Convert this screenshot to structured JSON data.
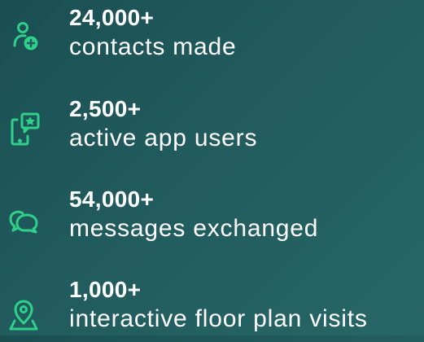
{
  "colors": {
    "background": "#215b5e",
    "accent": "#2fd08a",
    "text": "#ffffff"
  },
  "stats": [
    {
      "value": "24,000+",
      "label": "contacts made",
      "icon": "add-contact-icon"
    },
    {
      "value": "2,500+",
      "label": "active app users",
      "icon": "mobile-app-star-icon"
    },
    {
      "value": "54,000+",
      "label": "messages exchanged",
      "icon": "chat-bubbles-icon"
    },
    {
      "value": "1,000+",
      "label": "interactive floor plan visits",
      "icon": "location-pin-icon"
    }
  ]
}
